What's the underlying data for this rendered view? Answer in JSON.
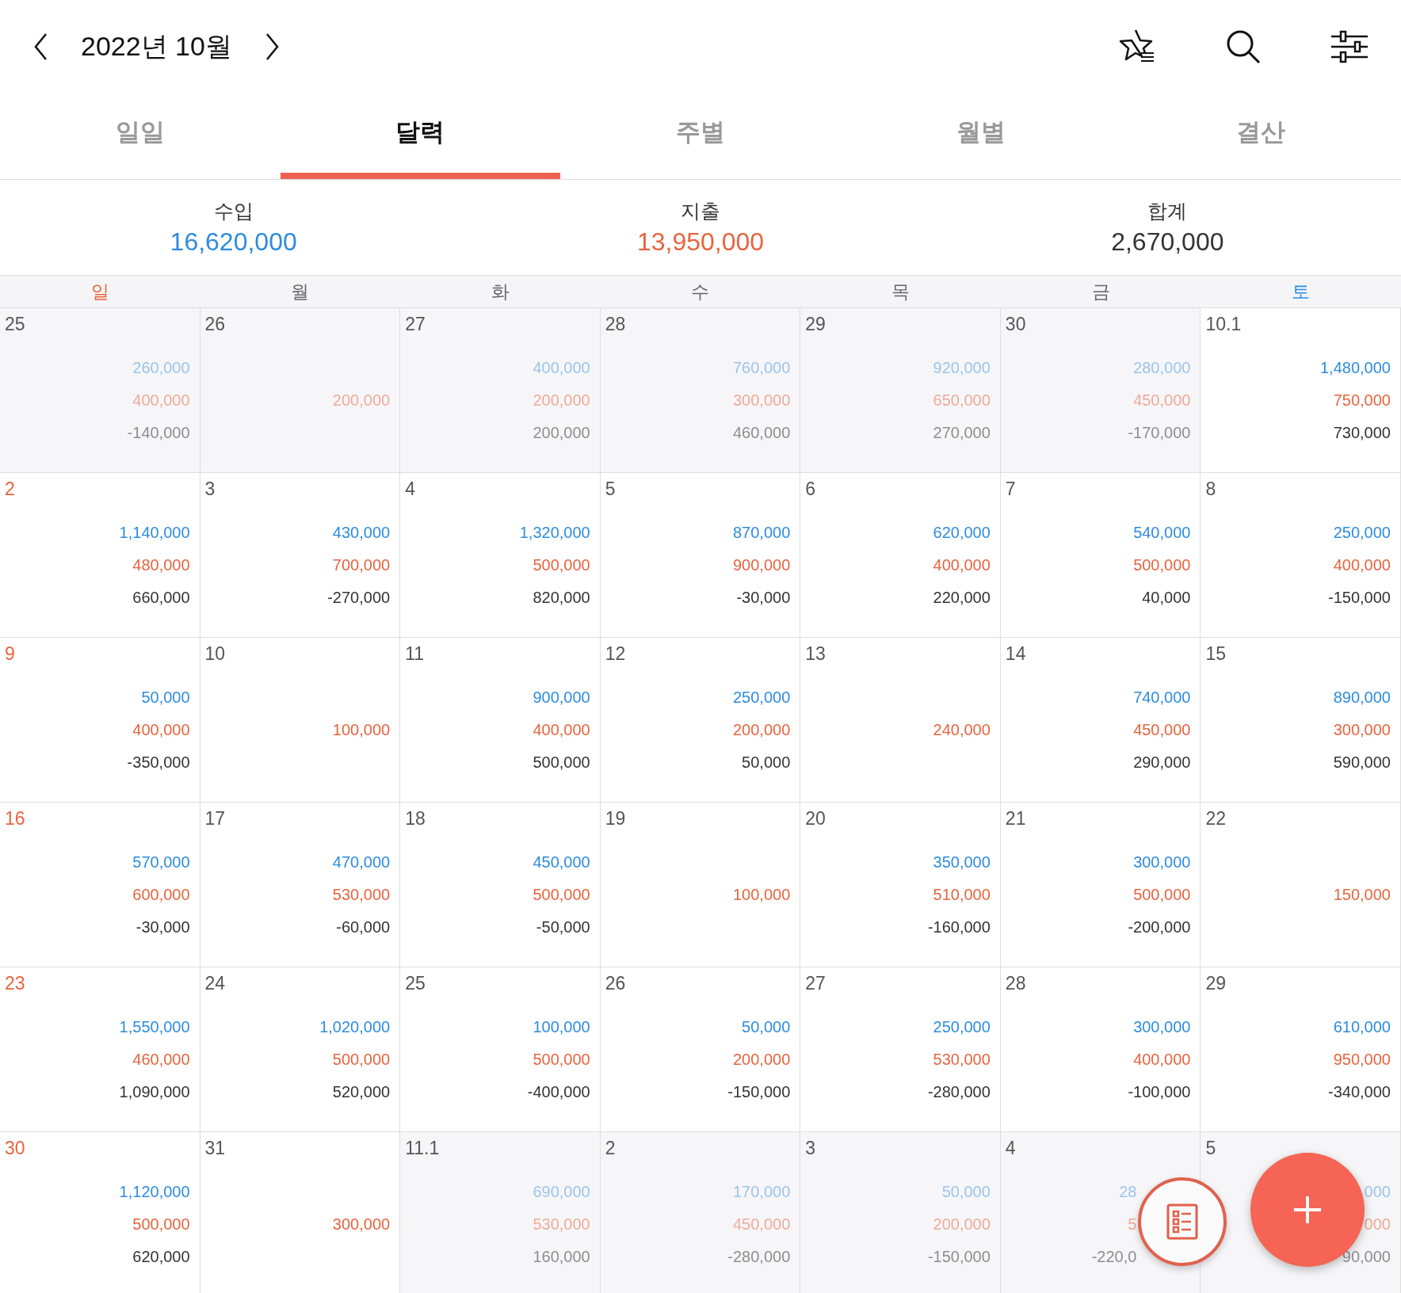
{
  "header": {
    "title": "2022년 10월"
  },
  "tabs": [
    {
      "label": "일일",
      "selected": false
    },
    {
      "label": "달력",
      "selected": true
    },
    {
      "label": "주별",
      "selected": false
    },
    {
      "label": "월별",
      "selected": false
    },
    {
      "label": "결산",
      "selected": false
    }
  ],
  "summary": [
    {
      "kind": "income",
      "label": "수입",
      "value": "16,620,000"
    },
    {
      "kind": "expense",
      "label": "지출",
      "value": "13,950,000"
    },
    {
      "kind": "total",
      "label": "합계",
      "value": "2,670,000"
    }
  ],
  "weekdays": [
    "일",
    "월",
    "화",
    "수",
    "목",
    "금",
    "토"
  ],
  "calendar": {
    "weeks": [
      [
        {
          "day": "25",
          "other_month": true,
          "kind": "plain",
          "income": "260,000",
          "expense": "400,000",
          "total": "-140,000"
        },
        {
          "day": "26",
          "other_month": true,
          "kind": "plain",
          "expense": "200,000"
        },
        {
          "day": "27",
          "other_month": true,
          "kind": "plain",
          "income": "400,000",
          "expense": "200,000",
          "total": "200,000"
        },
        {
          "day": "28",
          "other_month": true,
          "kind": "plain",
          "income": "760,000",
          "expense": "300,000",
          "total": "460,000"
        },
        {
          "day": "29",
          "other_month": true,
          "kind": "plain",
          "income": "920,000",
          "expense": "650,000",
          "total": "270,000"
        },
        {
          "day": "30",
          "other_month": true,
          "kind": "plain",
          "income": "280,000",
          "expense": "450,000",
          "total": "-170,000"
        },
        {
          "day": "10.1",
          "other_month": false,
          "kind": "plain",
          "income": "1,480,000",
          "expense": "750,000",
          "total": "730,000"
        }
      ],
      [
        {
          "day": "2",
          "other_month": false,
          "kind": "plain",
          "income": "1,140,000",
          "expense": "480,000",
          "total": "660,000"
        },
        {
          "day": "3",
          "other_month": false,
          "kind": "plain",
          "income": "430,000",
          "expense": "700,000",
          "total": "-270,000"
        },
        {
          "day": "4",
          "other_month": false,
          "kind": "plain",
          "income": "1,320,000",
          "expense": "500,000",
          "total": "820,000"
        },
        {
          "day": "5",
          "other_month": false,
          "kind": "plain",
          "income": "870,000",
          "expense": "900,000",
          "total": "-30,000"
        },
        {
          "day": "6",
          "other_month": false,
          "kind": "plain",
          "income": "620,000",
          "expense": "400,000",
          "total": "220,000"
        },
        {
          "day": "7",
          "other_month": false,
          "kind": "plain",
          "income": "540,000",
          "expense": "500,000",
          "total": "40,000"
        },
        {
          "day": "8",
          "other_month": false,
          "kind": "plain",
          "income": "250,000",
          "expense": "400,000",
          "total": "-150,000"
        }
      ],
      [
        {
          "day": "9",
          "other_month": false,
          "kind": "plain",
          "income": "50,000",
          "expense": "400,000",
          "total": "-350,000"
        },
        {
          "day": "10",
          "other_month": false,
          "kind": "plain",
          "expense": "100,000"
        },
        {
          "day": "11",
          "other_month": false,
          "kind": "plain",
          "income": "900,000",
          "expense": "400,000",
          "total": "500,000"
        },
        {
          "day": "12",
          "other_month": false,
          "kind": "plain",
          "income": "250,000",
          "expense": "200,000",
          "total": "50,000"
        },
        {
          "day": "13",
          "other_month": false,
          "kind": "plain",
          "expense": "240,000"
        },
        {
          "day": "14",
          "other_month": false,
          "kind": "plain",
          "income": "740,000",
          "expense": "450,000",
          "total": "290,000"
        },
        {
          "day": "15",
          "other_month": false,
          "kind": "plain",
          "income": "890,000",
          "expense": "300,000",
          "total": "590,000"
        }
      ],
      [
        {
          "day": "16",
          "other_month": false,
          "kind": "plain",
          "income": "570,000",
          "expense": "600,000",
          "total": "-30,000"
        },
        {
          "day": "17",
          "other_month": false,
          "kind": "plain",
          "income": "470,000",
          "expense": "530,000",
          "total": "-60,000"
        },
        {
          "day": "18",
          "other_month": false,
          "kind": "plain",
          "income": "450,000",
          "expense": "500,000",
          "total": "-50,000"
        },
        {
          "day": "19",
          "other_month": false,
          "kind": "plain",
          "expense": "100,000"
        },
        {
          "day": "20",
          "other_month": false,
          "kind": "plain",
          "income": "350,000",
          "expense": "510,000",
          "total": "-160,000"
        },
        {
          "day": "21",
          "other_month": false,
          "kind": "plain",
          "income": "300,000",
          "expense": "500,000",
          "total": "-200,000"
        },
        {
          "day": "22",
          "other_month": false,
          "kind": "plain",
          "expense": "150,000"
        }
      ],
      [
        {
          "day": "23",
          "other_month": false,
          "kind": "plain",
          "income": "1,550,000",
          "expense": "460,000",
          "total": "1,090,000"
        },
        {
          "day": "24",
          "other_month": false,
          "kind": "plain",
          "income": "1,020,000",
          "expense": "500,000",
          "total": "520,000"
        },
        {
          "day": "25",
          "other_month": false,
          "kind": "plain",
          "income": "100,000",
          "expense": "500,000",
          "total": "-400,000"
        },
        {
          "day": "26",
          "other_month": false,
          "kind": "plain",
          "income": "50,000",
          "expense": "200,000",
          "total": "-150,000"
        },
        {
          "day": "27",
          "other_month": false,
          "kind": "plain",
          "income": "250,000",
          "expense": "530,000",
          "total": "-280,000"
        },
        {
          "day": "28",
          "other_month": false,
          "kind": "plain",
          "income": "300,000",
          "expense": "400,000",
          "total": "-100,000"
        },
        {
          "day": "29",
          "other_month": false,
          "kind": "plain",
          "income": "610,000",
          "expense": "950,000",
          "total": "-340,000"
        }
      ],
      [
        {
          "day": "30",
          "other_month": false,
          "kind": "plain",
          "income": "1,120,000",
          "expense": "500,000",
          "total": "620,000"
        },
        {
          "day": "31",
          "other_month": false,
          "kind": "plain",
          "expense": "300,000"
        },
        {
          "day": "11.1",
          "other_month": true,
          "kind": "plain",
          "income": "690,000",
          "expense": "530,000",
          "total": "160,000"
        },
        {
          "day": "2",
          "other_month": true,
          "kind": "plain",
          "income": "170,000",
          "expense": "450,000",
          "total": "-280,000"
        },
        {
          "day": "3",
          "other_month": true,
          "kind": "plain",
          "income": "50,000",
          "expense": "200,000",
          "total": "-150,000"
        },
        {
          "day": "4",
          "other_month": true,
          "kind": "covered",
          "income": "28",
          "expense": "5",
          "total": "-220,0"
        },
        {
          "day": "5",
          "other_month": true,
          "kind": "plain",
          "income": "000",
          "expense": "000",
          "total": "90,000"
        }
      ]
    ]
  }
}
